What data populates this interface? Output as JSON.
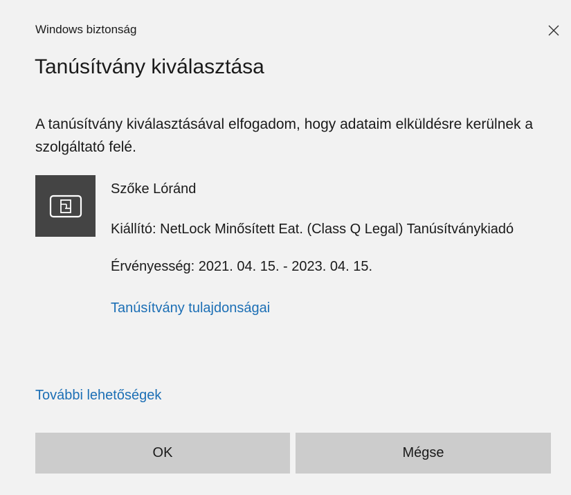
{
  "window": {
    "title": "Windows biztonság",
    "close_icon": "close-icon"
  },
  "dialog": {
    "heading": "Tanúsítvány kiválasztása",
    "description": "A tanúsítvány kiválasztásával elfogadom, hogy adataim elküldésre kerülnek a szolgáltató felé."
  },
  "certificate": {
    "icon": "certificate-card-icon",
    "name": "Szőke Lóránd",
    "issuer": "Kiállító: NetLock Minősített Eat. (Class Q Legal) Tanúsítványkiadó",
    "validity": "Érvényesség: 2021. 04. 15. - 2023. 04. 15.",
    "properties_link": "Tanúsítvány tulajdonságai"
  },
  "more_options_link": "További lehetőségek",
  "buttons": {
    "ok": "OK",
    "cancel": "Mégse"
  },
  "colors": {
    "background": "#f2f2f2",
    "link": "#1c6fb5",
    "button": "#cccccc",
    "tile": "#444444"
  }
}
